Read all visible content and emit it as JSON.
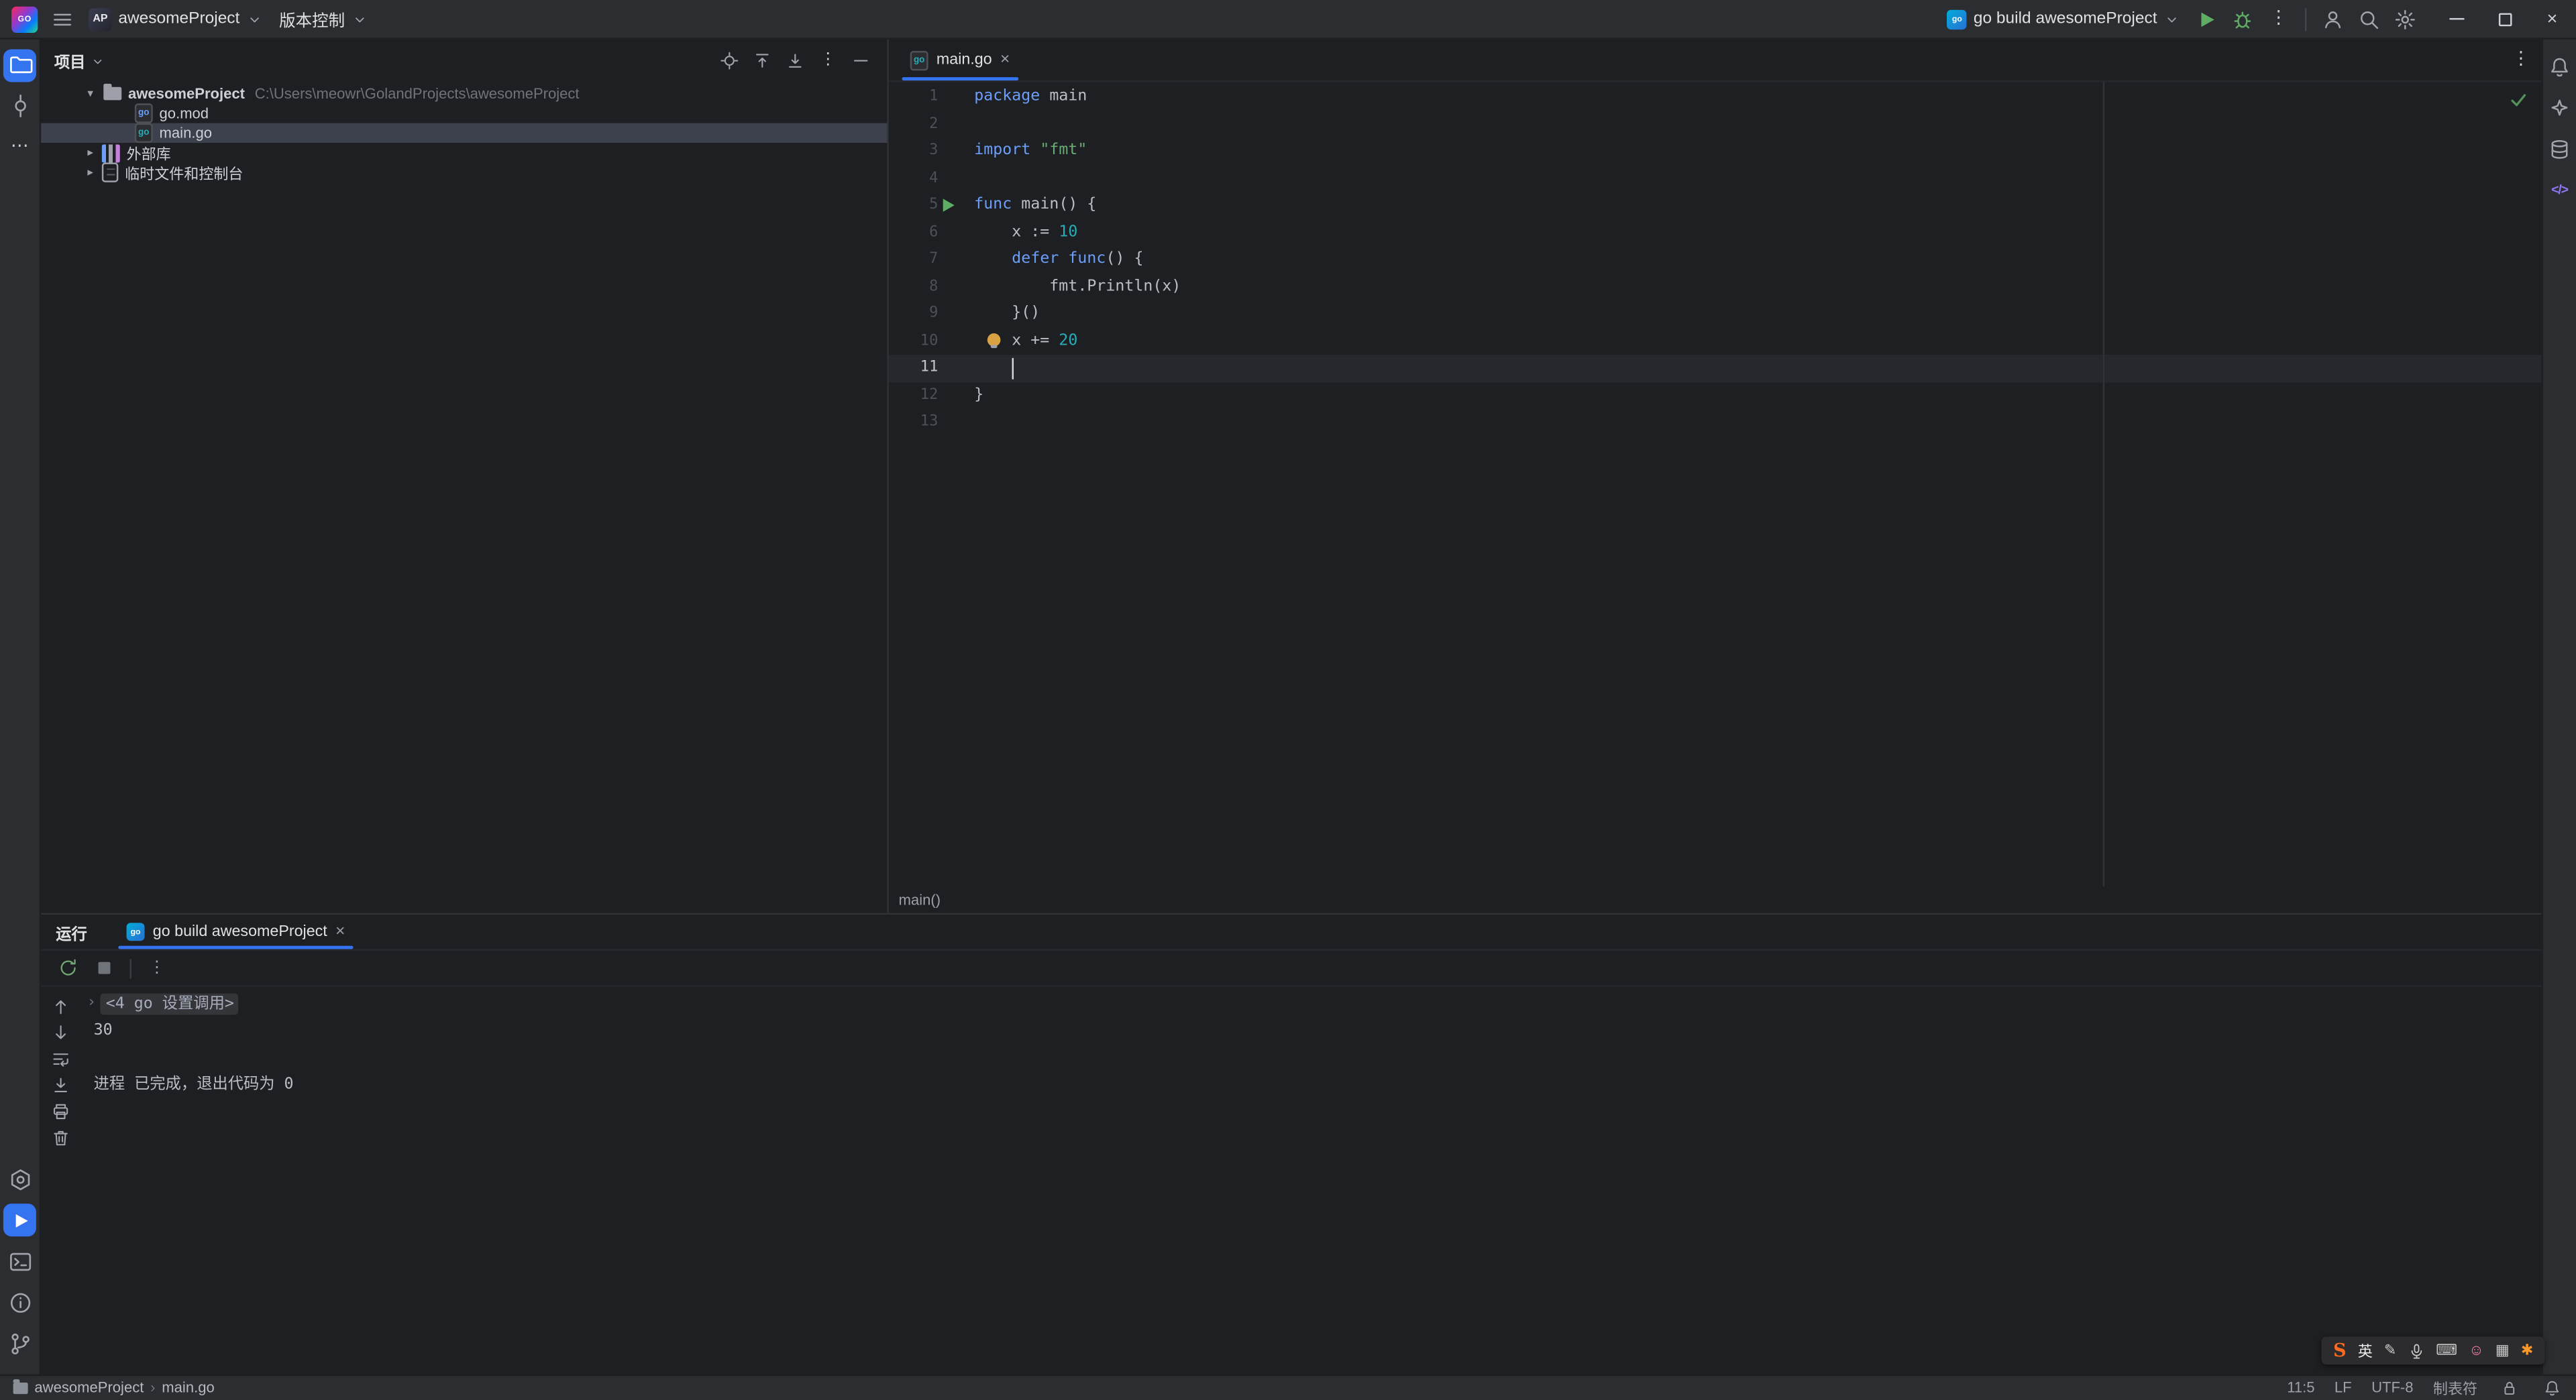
{
  "colors": {
    "accent": "#3574f0",
    "editor_bg": "#1e1f22",
    "panel_bg": "#2b2d30",
    "keyword": "#6c9ef8",
    "string": "#6aab73",
    "number": "#2aacb8",
    "text": "#bcbec4",
    "run_green": "#5fad65",
    "check_green": "#549159",
    "bulb_yellow": "#d9a343"
  },
  "icons": {
    "more_vertical": "⋮",
    "more_horizontal": "⋯",
    "chevron_down": "▾",
    "chevron_right": "▸",
    "close": "×",
    "breadcrumb_separator": "›",
    "fold_arrow": "›",
    "code_tags": "</>"
  },
  "title_bar": {
    "app_logo_text": "GO",
    "project_badge": "AP",
    "project_name": "awesomeProject",
    "vcs_label": "版本控制",
    "run_config_label": "go build awesomeProject",
    "run_config_icon_text": "go"
  },
  "project_panel": {
    "title": "项目",
    "tree": [
      {
        "indent": 0,
        "chevron": "down",
        "icon": "folder",
        "label": "awesomeProject",
        "path": "C:\\Users\\meowr\\GolandProjects\\awesomeProject",
        "selected": false
      },
      {
        "indent": 1,
        "chevron": "none",
        "icon": "go-mod",
        "label": "go.mod",
        "selected": false
      },
      {
        "indent": 1,
        "chevron": "none",
        "icon": "go-file",
        "label": "main.go",
        "selected": true
      },
      {
        "indent": 0,
        "chevron": "right",
        "icon": "library",
        "label": "外部库",
        "selected": false
      },
      {
        "indent": 0,
        "chevron": "right",
        "icon": "scratch",
        "label": "临时文件和控制台",
        "selected": false
      }
    ]
  },
  "editor": {
    "tab_label": "main.go",
    "tab_icon_text": "go",
    "breadcrumb": "main()",
    "caret": {
      "line": 11,
      "column": 5
    },
    "run_gutter_line": 5,
    "bulb_line": 10,
    "code_lines": [
      {
        "n": 1,
        "tokens": [
          {
            "t": "kw",
            "s": "package"
          },
          {
            "t": "pl",
            "s": " main"
          }
        ]
      },
      {
        "n": 2,
        "tokens": []
      },
      {
        "n": 3,
        "tokens": [
          {
            "t": "kw",
            "s": "import"
          },
          {
            "t": "pl",
            "s": " "
          },
          {
            "t": "str",
            "s": "\"fmt\""
          }
        ]
      },
      {
        "n": 4,
        "tokens": []
      },
      {
        "n": 5,
        "tokens": [
          {
            "t": "kw",
            "s": "func"
          },
          {
            "t": "pl",
            "s": " main() {"
          }
        ]
      },
      {
        "n": 6,
        "tokens": [
          {
            "t": "pl",
            "s": "    x := "
          },
          {
            "t": "num",
            "s": "10"
          }
        ]
      },
      {
        "n": 7,
        "tokens": [
          {
            "t": "pl",
            "s": "    "
          },
          {
            "t": "kw",
            "s": "defer"
          },
          {
            "t": "pl",
            "s": " "
          },
          {
            "t": "kw",
            "s": "func"
          },
          {
            "t": "pl",
            "s": "() {"
          }
        ]
      },
      {
        "n": 8,
        "tokens": [
          {
            "t": "pl",
            "s": "        fmt.Println(x)"
          }
        ]
      },
      {
        "n": 9,
        "tokens": [
          {
            "t": "pl",
            "s": "    }()"
          }
        ]
      },
      {
        "n": 10,
        "tokens": [
          {
            "t": "pl",
            "s": "    x += "
          },
          {
            "t": "num",
            "s": "20"
          }
        ]
      },
      {
        "n": 11,
        "tokens": []
      },
      {
        "n": 12,
        "tokens": [
          {
            "t": "pl",
            "s": "}"
          }
        ]
      },
      {
        "n": 13,
        "tokens": []
      }
    ]
  },
  "run_panel": {
    "title": "运行",
    "tab_label": "go build awesomeProject",
    "tab_icon_text": "go",
    "console": {
      "fold_line": "<4 go 设置调用>",
      "lines": [
        "30",
        "",
        "进程 已完成，退出代码为 0"
      ]
    }
  },
  "status_bar": {
    "breadcrumb": [
      "awesomeProject",
      "main.go"
    ],
    "caret_position": "11:5",
    "line_separator": "LF",
    "encoding": "UTF-8",
    "indent_style": "制表符"
  },
  "ime_bar": {
    "logo": "S",
    "lang": "英"
  }
}
